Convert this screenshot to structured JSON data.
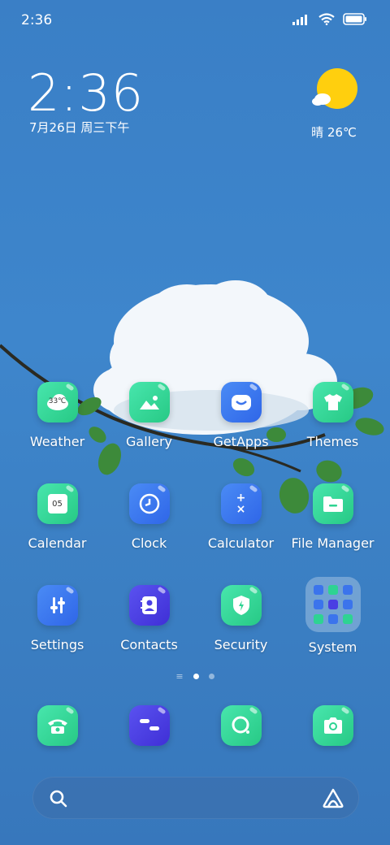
{
  "status_bar": {
    "time": "2:36"
  },
  "clock_widget": {
    "time": "2:36",
    "date": "7月26日 周三下午"
  },
  "weather_widget": {
    "temp": "晴 26℃"
  },
  "apps_row1": [
    {
      "label": "Weather",
      "icon": "weather-icon",
      "badge": "33℃"
    },
    {
      "label": "Gallery",
      "icon": "gallery-icon"
    },
    {
      "label": "GetApps",
      "icon": "getapps-icon"
    },
    {
      "label": "Themes",
      "icon": "themes-icon"
    }
  ],
  "apps_row2": [
    {
      "label": "Calendar",
      "icon": "calendar-icon",
      "badge": "05"
    },
    {
      "label": "Clock",
      "icon": "clock-icon"
    },
    {
      "label": "Calculator",
      "icon": "calculator-icon",
      "badge": "+\n×"
    },
    {
      "label": "File Manager",
      "icon": "folder-icon"
    }
  ],
  "apps_row3": [
    {
      "label": "Settings",
      "icon": "settings-icon"
    },
    {
      "label": "Contacts",
      "icon": "contacts-icon"
    },
    {
      "label": "Security",
      "icon": "security-icon"
    },
    {
      "label": "System",
      "icon": "system-folder-icon"
    }
  ],
  "dock": [
    {
      "icon": "phone-icon"
    },
    {
      "icon": "messages-icon"
    },
    {
      "icon": "browser-icon"
    },
    {
      "icon": "camera-icon"
    }
  ],
  "calendar_badge": "05",
  "weather_badge": "33℃",
  "colors": {
    "accent_green": "#2ed392",
    "accent_blue": "#3b74ec",
    "accent_indigo": "#4a3fe3"
  }
}
